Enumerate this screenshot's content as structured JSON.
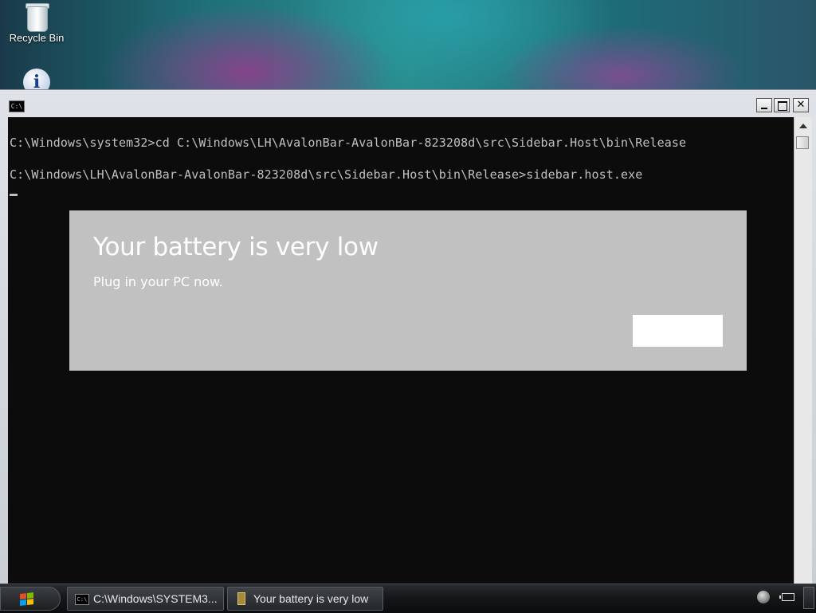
{
  "desktop": {
    "icons": [
      {
        "label": "Recycle Bin",
        "icon": "recycle-bin-icon"
      },
      {
        "label": "",
        "icon": "info-icon"
      }
    ]
  },
  "console": {
    "title_icon_text": "C:\\",
    "lines": [
      "C:\\Windows\\system32>cd C:\\Windows\\LH\\AvalonBar-AvalonBar-823208d\\src\\Sidebar.Host\\bin\\Release",
      "C:\\Windows\\LH\\AvalonBar-AvalonBar-823208d\\src\\Sidebar.Host\\bin\\Release>sidebar.host.exe"
    ],
    "controls": {
      "minimize": "minimize-icon",
      "maximize": "maximize-icon",
      "close": "✕"
    }
  },
  "toast": {
    "title": "Your battery is very low",
    "body": "Plug in your PC now.",
    "button_label": ""
  },
  "taskbar": {
    "tasks": [
      {
        "label": "C:\\Windows\\SYSTEM3...",
        "icon": "console-icon"
      },
      {
        "label": "Your battery is very low",
        "icon": "battery-icon"
      }
    ],
    "tray": [
      "volume-icon",
      "battery-icon"
    ]
  },
  "colors": {
    "console_bg": "#0c0c0c",
    "console_text": "#c0c0c0",
    "toast_bg": "#c1c1c1",
    "toast_text": "#ffffff"
  }
}
